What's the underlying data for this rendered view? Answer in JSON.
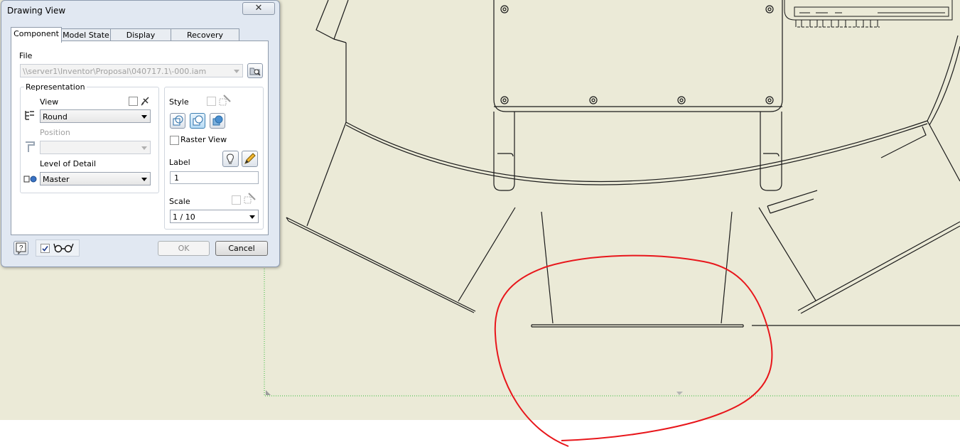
{
  "dialog": {
    "title": "Drawing View",
    "close_label": "✕",
    "tabs": [
      {
        "label": "Component",
        "active": true
      },
      {
        "label": "Model State",
        "active": false
      },
      {
        "label": "Display Options",
        "active": false
      },
      {
        "label": "Recovery Options",
        "active": false
      }
    ],
    "file": {
      "label": "File",
      "path": "\\\\server1\\Inventor\\Proposal\\040717.1\\-000.iam",
      "browse_icon": "folder-search-icon"
    },
    "representation": {
      "title": "Representation",
      "view_label": "View",
      "view_value": "Round",
      "position_label": "Position",
      "position_value": "",
      "lod_label": "Level of Detail",
      "lod_value": "Master"
    },
    "style": {
      "label": "Style",
      "selected": "hidden-line-removed",
      "raster_label": "Raster View",
      "raster_checked": false
    },
    "label_field": {
      "label": "Label",
      "value": "1"
    },
    "scale": {
      "label": "Scale",
      "value": "1 / 10"
    },
    "footer": {
      "help_icon": "help-icon",
      "preview_checked": true,
      "preview_icon": "glasses-icon",
      "ok_label": "OK",
      "cancel_label": "Cancel"
    }
  },
  "colors": {
    "sheet_background": "#ebead7",
    "dialog_background": "#e1e8f2",
    "markup_red": "#e8161b",
    "border_dotted": "#55c455"
  }
}
